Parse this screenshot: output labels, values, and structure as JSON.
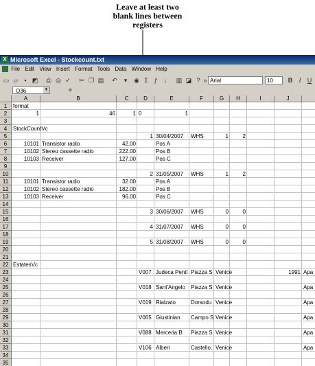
{
  "callout": {
    "lines": [
      "Leave at least two",
      "blank lines between",
      "registers"
    ]
  },
  "window": {
    "title": "Microsoft Excel - Stockcount.txt"
  },
  "menu": [
    "File",
    "Edit",
    "View",
    "Insert",
    "Format",
    "Tools",
    "Data",
    "Window",
    "Help"
  ],
  "toolbar": {
    "font_name": "Arial",
    "font_size": "10",
    "bold": "B",
    "italic": "I",
    "underline": "U"
  },
  "formula": {
    "name_box": "O36",
    "fx": "="
  },
  "columns": [
    "A",
    "B",
    "C",
    "D",
    "E",
    "F",
    "G",
    "H",
    "I",
    "J",
    ""
  ],
  "rows": [
    "1",
    "2",
    "3",
    "4",
    "5",
    "6",
    "7",
    "8",
    "9",
    "10",
    "11",
    "12",
    "13",
    "14",
    "15",
    "16",
    "17",
    "18",
    "19",
    "20",
    "21",
    "22",
    "23",
    "24",
    "25",
    "26",
    "27",
    "28",
    "29",
    "30",
    "31",
    "32",
    "33",
    "34",
    "35"
  ],
  "cells": {
    "r1": {
      "A": "format"
    },
    "r2": {
      "A": "1",
      "B": "46",
      "C": "1",
      "D": "0",
      "E": "1"
    },
    "r4": {
      "A": "StockCountVc"
    },
    "r5": {
      "D": "1",
      "E": "30/04/2007",
      "F": "WHS",
      "G": "1",
      "H": "2"
    },
    "r6": {
      "A": "10101",
      "B": "Transistor radio",
      "C": "42.00",
      "E": "Pos A"
    },
    "r7": {
      "A": "10102",
      "B": "Stereo cassette radio",
      "C": "222.00",
      "E": "Pos B"
    },
    "r8": {
      "A": "10103",
      "B": "Receiver",
      "C": "127.00",
      "E": "Pos C"
    },
    "r10": {
      "D": "2",
      "E": "31/05/2007",
      "F": "WHS",
      "G": "1",
      "H": "2"
    },
    "r11": {
      "A": "10101",
      "B": "Transistor radio",
      "C": "32.00",
      "E": "Pos A"
    },
    "r12": {
      "A": "10102",
      "B": "Stereo cassette radio",
      "C": "182.00",
      "E": "Pos B"
    },
    "r13": {
      "A": "10103",
      "B": "Receiver",
      "C": "96.00",
      "E": "Pos C"
    },
    "r15": {
      "D": "3",
      "E": "30/06/2007",
      "F": "WHS",
      "G": "0",
      "H": "0"
    },
    "r17": {
      "D": "4",
      "E": "31/07/2007",
      "F": "WHS",
      "G": "0",
      "H": "0"
    },
    "r19": {
      "D": "5",
      "E": "31/08/2007",
      "F": "WHS",
      "G": "0",
      "H": "0"
    },
    "r22": {
      "A": "EstatesVc"
    },
    "r23": {
      "D": "V007",
      "E": "Judeca Pentl",
      "F": "Piazza S",
      "G": "Venice",
      "J": "1991",
      "K": "Apa"
    },
    "r25": {
      "D": "V018",
      "E": "Sant'Angelo",
      "F": "Piazza S",
      "G": "Venice",
      "K": "Apa"
    },
    "r27": {
      "D": "V019",
      "E": "Rialzato",
      "F": "Dorsodu",
      "G": "Venice",
      "K": "Apa"
    },
    "r29": {
      "D": "V065",
      "E": "Giustinian",
      "F": "Campo S",
      "G": "Venice",
      "K": "Apa"
    },
    "r31": {
      "D": "V088",
      "E": "Merceria B",
      "F": "Piazza S",
      "G": "Venice",
      "K": "Apa"
    },
    "r33": {
      "D": "V106",
      "E": "Alberi",
      "F": "Castello,",
      "G": "Venice",
      "K": "Apa"
    }
  },
  "right_aligned": {
    "r2": [
      "A",
      "B",
      "C",
      "E"
    ],
    "r5": [
      "D",
      "G",
      "H"
    ],
    "r6": [
      "A",
      "C"
    ],
    "r7": [
      "A",
      "C"
    ],
    "r8": [
      "A",
      "C"
    ],
    "r10": [
      "D",
      "G",
      "H"
    ],
    "r11": [
      "A",
      "C"
    ],
    "r12": [
      "A",
      "C"
    ],
    "r13": [
      "A",
      "C"
    ],
    "r15": [
      "D",
      "G",
      "H"
    ],
    "r17": [
      "D",
      "G",
      "H"
    ],
    "r19": [
      "D",
      "G",
      "H"
    ],
    "r23": [
      "J"
    ]
  }
}
